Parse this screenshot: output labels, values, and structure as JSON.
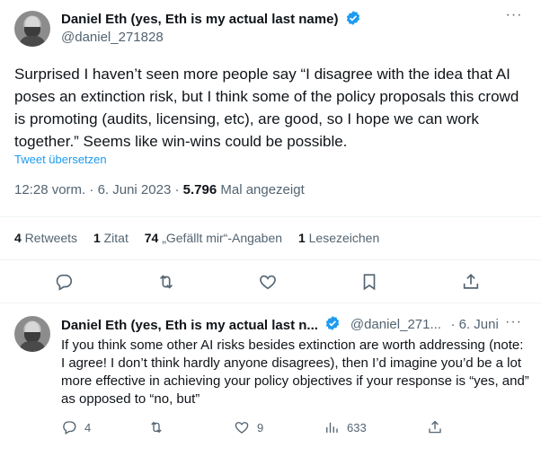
{
  "tweet": {
    "author_name": "Daniel Eth (yes, Eth is my actual last name)",
    "author_handle": "@daniel_271828",
    "more_label": "···",
    "text": "Surprised I haven’t seen more people say “I disagree with the idea that AI poses an extinction risk, but I think some of the policy proposals this crowd is promoting (audits, licensing, etc), are good, so I hope we can work together.”  Seems like win-wins could be possible.",
    "translate_label": "Tweet übersetzen",
    "time": "12:28 vorm.",
    "separator": " · ",
    "date": "6. Juni 2023",
    "views_count": "5.796",
    "views_label": " Mal angezeigt",
    "stats": {
      "retweets_count": "4",
      "retweets_label": " Retweets",
      "quotes_count": "1",
      "quotes_label": " Zitat",
      "likes_count": "74",
      "likes_label": " „Gefällt mir“-Angaben",
      "bookmarks_count": "1",
      "bookmarks_label": " Lesezeichen"
    },
    "actions": [
      "reply-icon",
      "retweet-icon",
      "like-icon",
      "bookmark-icon",
      "share-icon"
    ]
  },
  "reply": {
    "author_name": "Daniel Eth (yes, Eth is my actual last n...",
    "author_handle": "@daniel_271...",
    "date": "· 6. Juni",
    "more_label": "···",
    "text": "If you think some other AI risks besides extinction are worth addressing (note: I agree! I don’t think hardly anyone disagrees), then I’d imagine you’d be a lot more effective in achieving your policy objectives if your response is “yes, and” as opposed to “no, but”",
    "actions": {
      "reply_count": "4",
      "retweet_count": "",
      "like_count": "9",
      "views_count": "633"
    }
  },
  "colors": {
    "verified": "#1d9bf0",
    "text": "#0f1419",
    "secondary": "#536471",
    "link": "#1d9bf0"
  }
}
